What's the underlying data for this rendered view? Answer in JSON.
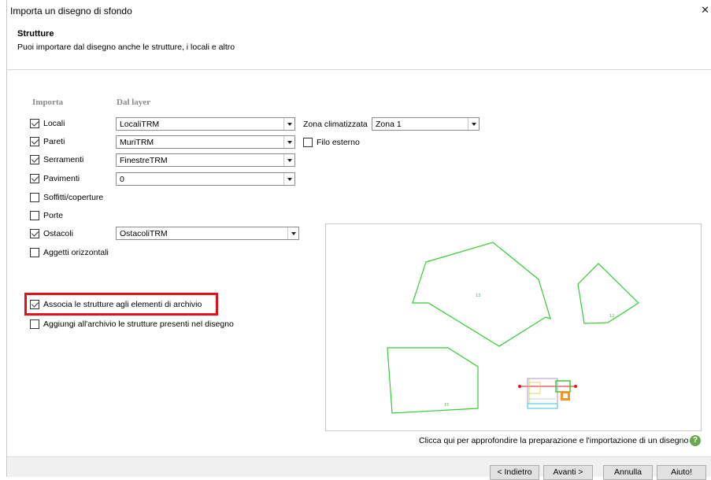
{
  "window": {
    "title": "Importa un disegno di sfondo",
    "close_glyph": "✕"
  },
  "header": {
    "title": "Strutture",
    "subtitle": "Puoi importare dal disegno anche le strutture, i locali e altro"
  },
  "columns": {
    "importa": "Importa",
    "dal_layer": "Dal layer"
  },
  "rows": [
    {
      "label": "Locali",
      "checked": true,
      "layer": "LocaliTRM"
    },
    {
      "label": "Pareti",
      "checked": true,
      "layer": "MuriTRM"
    },
    {
      "label": "Serramenti",
      "checked": true,
      "layer": "FinestreTRM"
    },
    {
      "label": "Pavimenti",
      "checked": true,
      "layer": "0"
    },
    {
      "label": "Soffitti/coperture",
      "checked": false,
      "layer": ""
    },
    {
      "label": "Porte",
      "checked": false,
      "layer": ""
    },
    {
      "label": "Ostacoli",
      "checked": true,
      "layer": "OstacoliTRM"
    },
    {
      "label": "Aggetti orizzontali",
      "checked": false,
      "layer": ""
    }
  ],
  "zona": {
    "label": "Zona climatizzata",
    "value": "Zona 1"
  },
  "filo_esterno": {
    "label": "Filo esterno",
    "checked": false
  },
  "associa": {
    "label": "Associa le strutture agli elementi di archivio",
    "checked": true
  },
  "aggiungi": {
    "label": "Aggiungi all'archivio le strutture presenti nel disegno",
    "checked": false
  },
  "preview": {
    "labels": [
      "13",
      "12",
      "15"
    ]
  },
  "help": {
    "text": "Clicca qui per approfondire la preparazione e l'importazione di un disegno",
    "icon": "question-icon",
    "glyph": "?"
  },
  "buttons": {
    "back": "< Indietro",
    "next": "Avanti >",
    "cancel": "Annulla",
    "help": "Aiuto!"
  },
  "colors": {
    "highlight": "#e2111a",
    "polygon": "#33cc33",
    "help_icon": "#6aa84f"
  }
}
